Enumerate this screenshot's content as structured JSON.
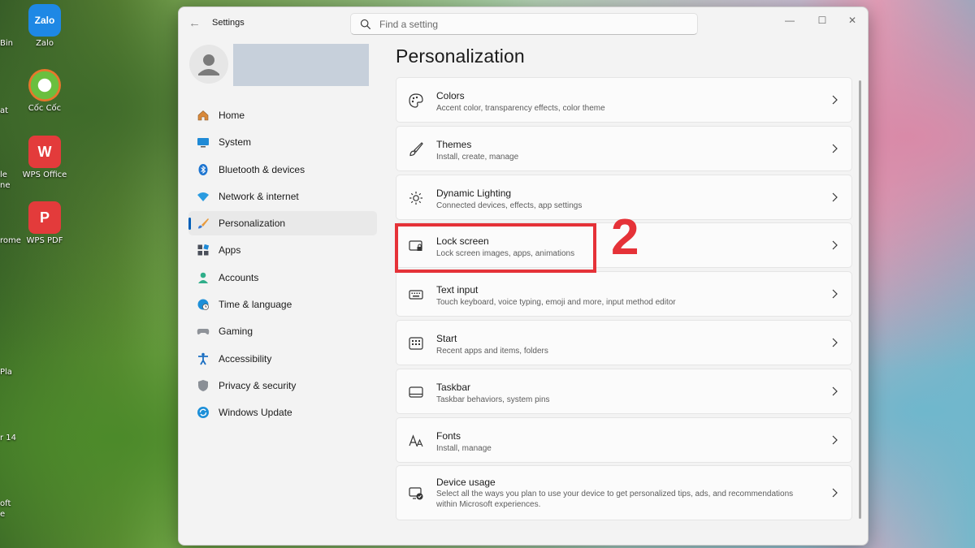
{
  "desktop": {
    "icons": [
      {
        "label": "Zalo",
        "tile": "Zalo",
        "color": "#1e88e5"
      },
      {
        "label": "Cốc Cốc",
        "tile": "",
        "color": "#6abf3f"
      },
      {
        "label": "WPS Office",
        "tile": "W",
        "color": "#e33b3b"
      },
      {
        "label": "WPS PDF",
        "tile": "P",
        "color": "#e33b3b"
      }
    ],
    "edge_labels": [
      "Bin",
      "at",
      "le",
      "ne",
      "rome",
      "Pla",
      "r 14",
      "oft",
      "e"
    ]
  },
  "window": {
    "app_title": "Settings",
    "search": {
      "placeholder": "Find a setting"
    },
    "controls": {
      "minimize": "—",
      "maximize": "☐",
      "close": "✕"
    }
  },
  "sidebar": {
    "items": [
      {
        "label": "Home",
        "icon": "home-icon"
      },
      {
        "label": "System",
        "icon": "system-icon"
      },
      {
        "label": "Bluetooth & devices",
        "icon": "bluetooth-icon"
      },
      {
        "label": "Network & internet",
        "icon": "wifi-icon"
      },
      {
        "label": "Personalization",
        "icon": "brush-icon",
        "active": true
      },
      {
        "label": "Apps",
        "icon": "apps-icon"
      },
      {
        "label": "Accounts",
        "icon": "accounts-icon"
      },
      {
        "label": "Time & language",
        "icon": "globe-clock-icon"
      },
      {
        "label": "Gaming",
        "icon": "gamepad-icon"
      },
      {
        "label": "Accessibility",
        "icon": "accessibility-icon"
      },
      {
        "label": "Privacy & security",
        "icon": "shield-icon"
      },
      {
        "label": "Windows Update",
        "icon": "update-icon"
      }
    ]
  },
  "main": {
    "title": "Personalization",
    "cards": [
      {
        "title": "Colors",
        "subtitle": "Accent color, transparency effects, color theme",
        "icon": "palette-icon"
      },
      {
        "title": "Themes",
        "subtitle": "Install, create, manage",
        "icon": "paintbrush-icon"
      },
      {
        "title": "Dynamic Lighting",
        "subtitle": "Connected devices, effects, app settings",
        "icon": "lighting-icon"
      },
      {
        "title": "Lock screen",
        "subtitle": "Lock screen images, apps, animations",
        "icon": "lock-screen-icon"
      },
      {
        "title": "Text input",
        "subtitle": "Touch keyboard, voice typing, emoji and more, input method editor",
        "icon": "keyboard-icon"
      },
      {
        "title": "Start",
        "subtitle": "Recent apps and items, folders",
        "icon": "start-icon"
      },
      {
        "title": "Taskbar",
        "subtitle": "Taskbar behaviors, system pins",
        "icon": "taskbar-icon"
      },
      {
        "title": "Fonts",
        "subtitle": "Install, manage",
        "icon": "fonts-icon"
      },
      {
        "title": "Device usage",
        "subtitle": "Select all the ways you plan to use your device to get personalized tips, ads, and recommendations within Microsoft experiences.",
        "icon": "device-usage-icon"
      }
    ]
  },
  "annotation": {
    "step": "2",
    "color": "#e53238"
  }
}
